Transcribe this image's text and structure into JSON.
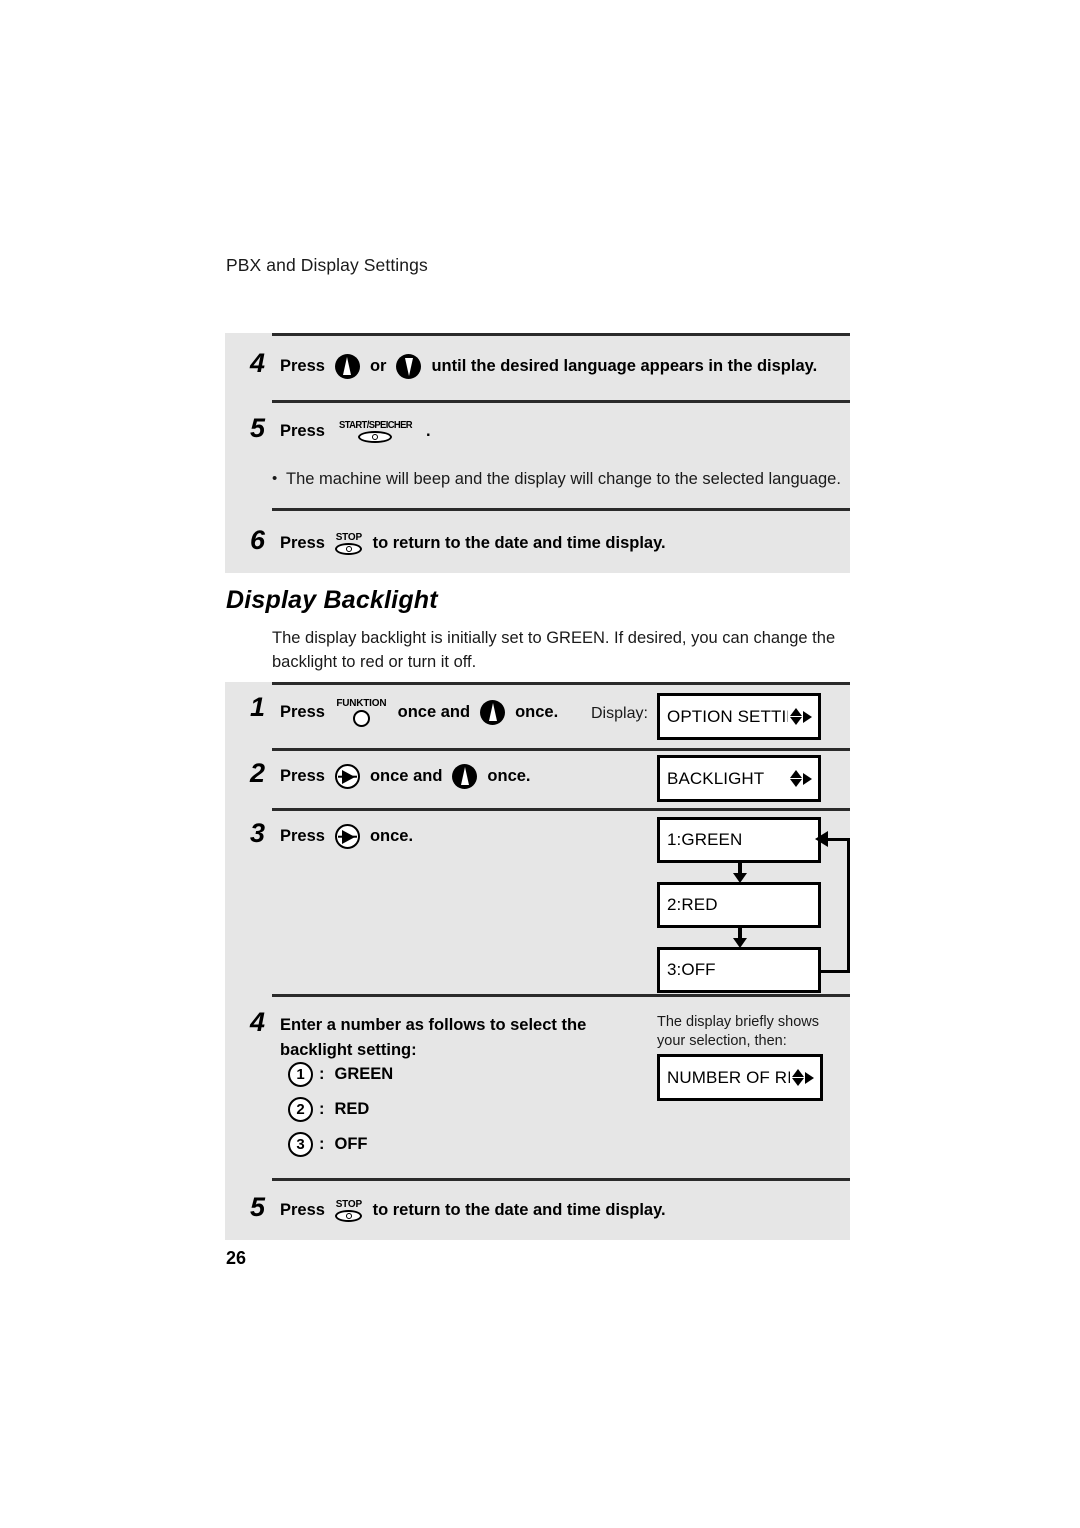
{
  "page": {
    "running_head": "PBX and Display Settings",
    "folio": "26"
  },
  "top_panel": {
    "steps": [
      {
        "number": "4",
        "press_label": "Press",
        "or_label": "or",
        "tail": "until the desired language appears in the display.",
        "keys": [
          "up-arrow-key",
          "down-arrow-key"
        ]
      },
      {
        "number": "5",
        "press_label": "Press",
        "key_label": "START/SPEICHER",
        "period": ".",
        "bullet": "The machine will beep and the display will change to the selected language."
      },
      {
        "number": "6",
        "press_label": "Press",
        "key_label": "STOP",
        "tail": "to return to the date and time display."
      }
    ]
  },
  "section": {
    "heading": "Display Backlight",
    "intro": "The display backlight is initially set to GREEN. If desired, you can change the backlight to red or turn it off."
  },
  "main_panel": {
    "display_label": "Display:",
    "steps": [
      {
        "number": "1",
        "press_label": "Press",
        "key_label": "FUNKTION",
        "mid_label": "once and",
        "end_label": "once.",
        "lcd": "OPTION SETTING"
      },
      {
        "number": "2",
        "press_label": "Press",
        "mid_label": "once and",
        "end_label": "once.",
        "lcd": "BACKLIGHT"
      },
      {
        "number": "3",
        "press_label": "Press",
        "end_label": "once.",
        "lcd_cycle": [
          "1:GREEN",
          "2:RED",
          "3:OFF"
        ]
      },
      {
        "number": "4",
        "line1": "Enter a number as follows to select the",
        "line2": "backlight setting:",
        "options": [
          {
            "key": "1",
            "separator": ":",
            "label": "GREEN"
          },
          {
            "key": "2",
            "separator": ":",
            "label": "RED"
          },
          {
            "key": "3",
            "separator": ":",
            "label": "OFF"
          }
        ],
        "note_line1": "The display briefly shows",
        "note_line2": "your selection, then:",
        "lcd": "NUMBER OF RING"
      },
      {
        "number": "5",
        "press_label": "Press",
        "key_label": "STOP",
        "tail": "to return to the date and time display."
      }
    ]
  },
  "colors": {
    "panel_bg": "#e6e6e6",
    "rule": "#2b2b2b",
    "ink": "#000000"
  }
}
